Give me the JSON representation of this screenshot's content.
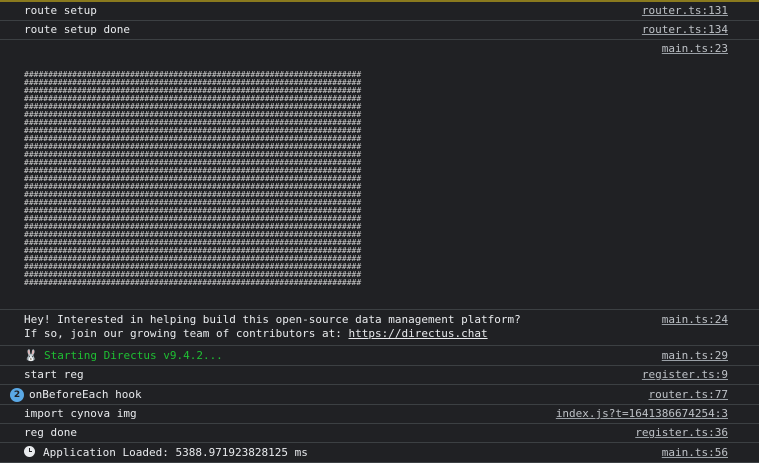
{
  "logs": [
    {
      "message": "route setup",
      "source": "router.ts:131"
    },
    {
      "message": "route setup done",
      "source": "router.ts:134"
    },
    {
      "message": "",
      "source": "main.ts:23"
    },
    {
      "message_line1": "Hey! Interested in helping build this open-source data management platform?",
      "message_line2_prefix": "If so, join our growing team of contributors at: ",
      "link": "https://directus.chat",
      "source": "main.ts:24"
    },
    {
      "icon": "🐰",
      "message": "Starting Directus v9.4.2...",
      "source": "main.ts:29"
    },
    {
      "message": "start reg",
      "source": "register.ts:9"
    },
    {
      "badge": "2",
      "message": "onBeforeEach hook",
      "source": "router.ts:77"
    },
    {
      "message": "import cynova img",
      "source": "index.js?t=1641386674254:3"
    },
    {
      "message": "reg done",
      "source": "register.ts:36"
    },
    {
      "message": "Application Loaded: 5388.971923828125 ms",
      "source": "main.ts:56"
    }
  ],
  "colors": {
    "background": "#202124",
    "divider": "#3c4043",
    "success": "#1fbf33",
    "badge": "#5aa9e6"
  },
  "icons": [
    "rabbit-emoji-icon",
    "clock-icon"
  ]
}
